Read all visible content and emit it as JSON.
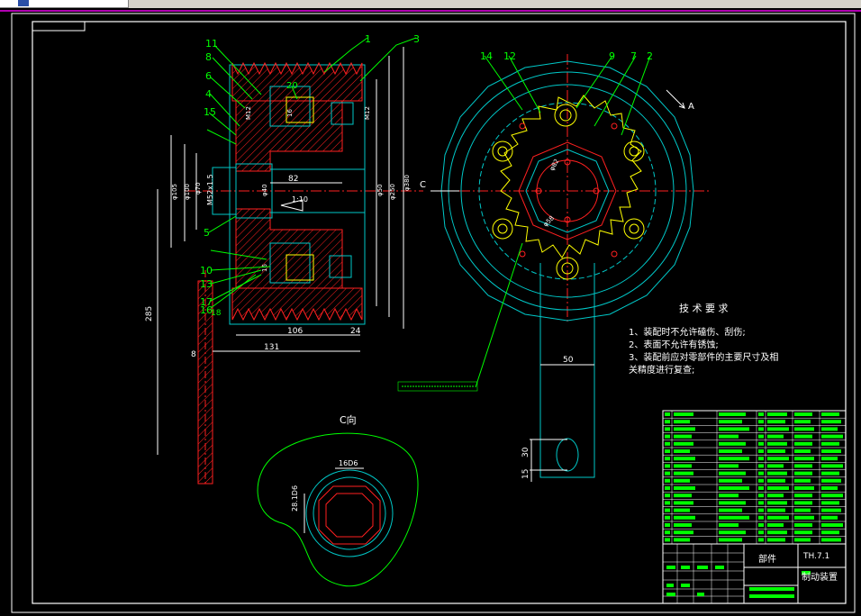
{
  "colors": {
    "background": "#000000",
    "frame": "#ffffff",
    "outline": "#00c8c8",
    "centerline": "#ff2020",
    "hatch": "#ff2020",
    "dimension": "#ffffff",
    "callout": "#00ff00",
    "highlight": "#ffff00",
    "window_chrome": "#d4d0c8",
    "accent_bar": "#b000b0"
  },
  "part_numbers": {
    "n1": "1",
    "n2": "2",
    "n3": "3",
    "n4": "4",
    "n5": "5",
    "n6": "6",
    "n7": "7",
    "n8": "8",
    "n9": "9",
    "n10": "10",
    "n11": "11",
    "n12": "12",
    "n13": "13",
    "n14": "14",
    "n15": "15",
    "n16": "16",
    "n17": "17",
    "n18": "18",
    "n20": "20"
  },
  "dimensions": {
    "d285": "285",
    "d131": "131",
    "d106": "106",
    "d24": "24",
    "d8": "8",
    "d50": "50",
    "d30": "30",
    "d15": "15",
    "d82": "82",
    "taper": "1:10",
    "thread": "M52x1.5",
    "dia105": "φ105",
    "dia100": "φ100",
    "dia70": "φ70",
    "dia40": "φ40",
    "dia50": "φ50",
    "dia250": "φ250",
    "dia380": "φ380",
    "dia82": "φ82",
    "m12a": "M12",
    "m12b": "M12",
    "k16": "16",
    "h16": "16",
    "d58": "φ58",
    "key": "16D6",
    "keydepth": "28.1D6"
  },
  "views": {
    "arrow_a": "A",
    "section_c": "C",
    "detail_title": "C向"
  },
  "tech": {
    "title": "技 术 要 求",
    "item1": "1、装配时不允许磕伤、刮伤;",
    "item2": "2、表面不允许有锈蚀;",
    "item3": "3、装配前应对零部件的主要尺寸及相",
    "item3b": "关精度进行复查;"
  },
  "title_block": {
    "component": "部件",
    "drawing_no": "TH.7.1",
    "name": "制动装置"
  }
}
